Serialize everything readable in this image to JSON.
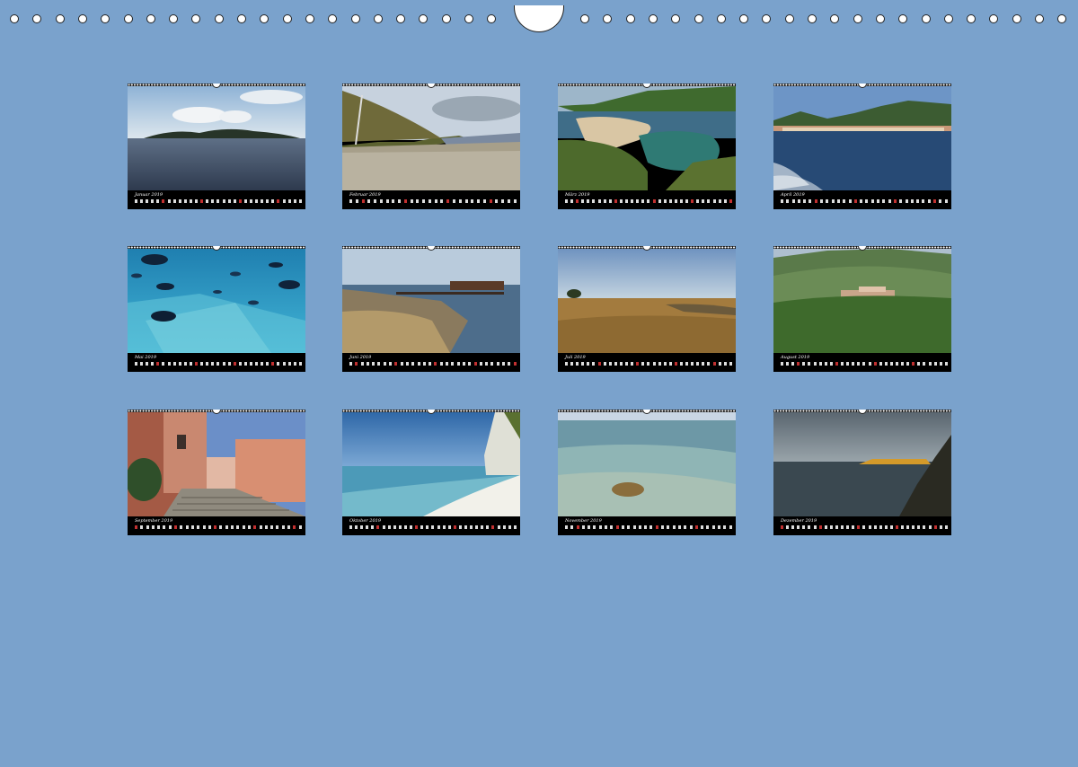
{
  "calendar": {
    "binding_hole_count_left": 22,
    "binding_hole_count_right": 22,
    "months": [
      {
        "label": "Januar 2019",
        "scene": "sea-island",
        "sundays": [
          6,
          13,
          20,
          27
        ],
        "days": 31
      },
      {
        "label": "Februar 2019",
        "scene": "pebble-beach",
        "sundays": [
          3,
          10,
          17,
          24
        ],
        "days": 28
      },
      {
        "label": "März 2019",
        "scene": "lagoon-coast",
        "sundays": [
          3,
          10,
          17,
          24,
          31
        ],
        "days": 31
      },
      {
        "label": "April 2019",
        "scene": "harbor-town",
        "sundays": [
          7,
          14,
          21,
          28
        ],
        "days": 30
      },
      {
        "label": "Mai 2019",
        "scene": "underwater-fish",
        "sundays": [
          5,
          12,
          19,
          26
        ],
        "days": 31
      },
      {
        "label": "Juni 2019",
        "scene": "pier-cliff",
        "sundays": [
          2,
          9,
          16,
          23,
          30
        ],
        "days": 30
      },
      {
        "label": "Juli 2019",
        "scene": "dry-field",
        "sundays": [
          7,
          14,
          21,
          28
        ],
        "days": 31
      },
      {
        "label": "August 2019",
        "scene": "hill-village",
        "sundays": [
          4,
          11,
          18,
          25
        ],
        "days": 31
      },
      {
        "label": "September 2019",
        "scene": "village-stairs",
        "sundays": [
          1,
          8,
          15,
          22,
          29
        ],
        "days": 30
      },
      {
        "label": "Oktober 2019",
        "scene": "white-beach",
        "sundays": [
          6,
          13,
          20,
          27
        ],
        "days": 31
      },
      {
        "label": "November 2019",
        "scene": "clear-water",
        "sundays": [
          3,
          10,
          17,
          24
        ],
        "days": 30
      },
      {
        "label": "Dezember 2019",
        "scene": "dusk-headland",
        "sundays": [
          1,
          8,
          15,
          22,
          29
        ],
        "days": 31
      }
    ]
  },
  "colors": {
    "background": "#7aa2cc",
    "strip": "#000000",
    "sunday": "#c23030"
  }
}
